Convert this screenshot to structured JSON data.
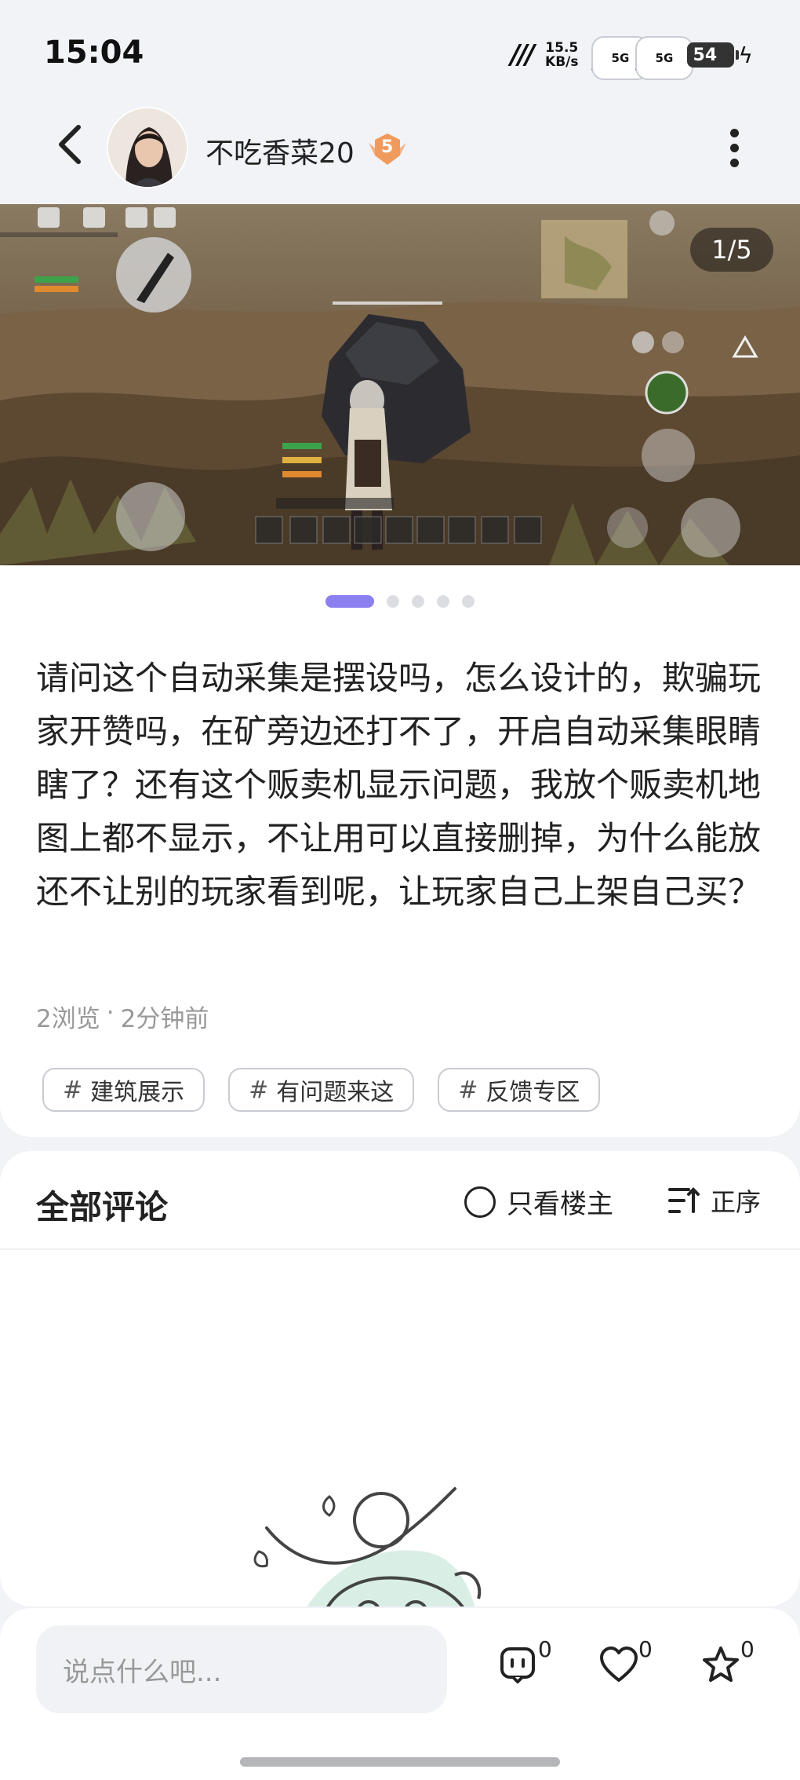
{
  "status_bar": {
    "time": "15:04",
    "net_speed_value": "15.5",
    "net_speed_unit": "KB/s",
    "signal_1_label": "5G",
    "signal_2_label": "5G",
    "battery": "54"
  },
  "header": {
    "username": "不吃香菜20",
    "level": "5"
  },
  "gallery": {
    "page_indicator": "1/5",
    "total_images": 5,
    "current_index": 1
  },
  "post": {
    "text": "请问这个自动采集是摆设吗，怎么设计的，欺骗玩家开赞吗，在矿旁边还打不了，开启自动采集眼睛瞎了？还有这个贩卖机显示问题，我放个贩卖机地图上都不显示，不让用可以直接删掉，为什么能放还不让别的玩家看到呢，让玩家自己上架自己买？",
    "views": "2浏览",
    "separator": "·",
    "time_ago": "2分钟前",
    "tags": [
      {
        "label": "建筑展示"
      },
      {
        "label": "有问题来这"
      },
      {
        "label": "反馈专区"
      }
    ]
  },
  "comments": {
    "title": "全部评论",
    "only_op_label": "只看楼主",
    "sort_label": "正序"
  },
  "bottom_bar": {
    "input_placeholder": "说点什么吧...",
    "comment_count": "0",
    "like_count": "0",
    "favorite_count": "0"
  },
  "colors": {
    "accent": "#8b80f0",
    "background": "#f1f3f7",
    "badge": "#f0a060"
  }
}
